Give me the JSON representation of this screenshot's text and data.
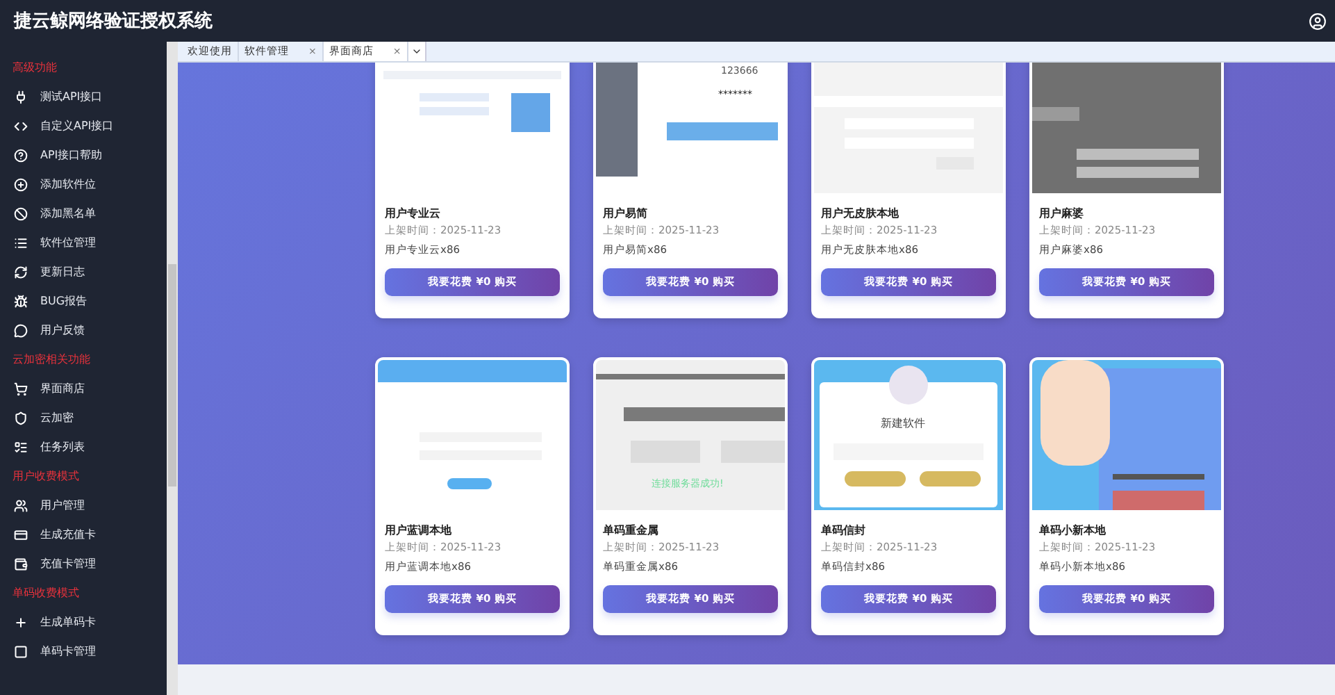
{
  "header": {
    "title": "捷云鲸网络验证授权系统"
  },
  "sidebar": {
    "items": [
      {
        "kind": "section",
        "label": "高级功能"
      },
      {
        "kind": "item",
        "label": "测试API接口"
      },
      {
        "kind": "item",
        "label": "自定义API接口"
      },
      {
        "kind": "item",
        "label": "API接口帮助"
      },
      {
        "kind": "item",
        "label": "添加软件位"
      },
      {
        "kind": "item",
        "label": "添加黑名单"
      },
      {
        "kind": "item",
        "label": "软件位管理"
      },
      {
        "kind": "item",
        "label": "更新日志"
      },
      {
        "kind": "item",
        "label": "BUG报告"
      },
      {
        "kind": "item",
        "label": "用户反馈"
      },
      {
        "kind": "section",
        "label": "云加密相关功能"
      },
      {
        "kind": "item",
        "label": "界面商店"
      },
      {
        "kind": "item",
        "label": "云加密"
      },
      {
        "kind": "item",
        "label": "任务列表"
      },
      {
        "kind": "section",
        "label": "用户收费模式"
      },
      {
        "kind": "item",
        "label": "用户管理"
      },
      {
        "kind": "item",
        "label": "生成充值卡"
      },
      {
        "kind": "item",
        "label": "充值卡管理"
      },
      {
        "kind": "section",
        "label": "单码收费模式"
      },
      {
        "kind": "item",
        "label": "生成单码卡"
      },
      {
        "kind": "item",
        "label": "单码卡管理"
      }
    ]
  },
  "tabs": [
    {
      "label": "欢迎使用",
      "selected": false
    },
    {
      "label": "软件管理",
      "selected": false,
      "close": "×"
    },
    {
      "label": "界面商店",
      "selected": true,
      "close": "×"
    }
  ],
  "cards": [
    {
      "name": "用户专业云",
      "date": "上架时间：2025-11-23",
      "desc": "用户专业云x86",
      "button": "我要花费 ¥0 购买",
      "preview": {
        "kind": "web"
      }
    },
    {
      "name": "用户易简",
      "date": "上架时间：2025-11-23",
      "desc": "用户易简x86",
      "button": "我要花费 ¥0 购买",
      "preview": {
        "kind": "side-login",
        "texts": [
          "123666",
          "*******"
        ]
      }
    },
    {
      "name": "用户无皮肤本地",
      "date": "上架时间：2025-11-23",
      "desc": "用户无皮肤本地x86",
      "button": "我要花费 ¥0 购买",
      "preview": {
        "kind": "plain-login"
      }
    },
    {
      "name": "用户麻婆",
      "date": "上架时间：2025-11-23",
      "desc": "用户麻婆x86",
      "button": "我要花费 ¥0 购买",
      "preview": {
        "kind": "dark-login"
      }
    },
    {
      "name": "用户蓝调本地",
      "date": "上架时间：2025-11-23",
      "desc": "用户蓝调本地x86",
      "button": "我要花费 ¥0 购买",
      "preview": {
        "kind": "blue-login"
      }
    },
    {
      "name": "单码重金属",
      "date": "上架时间：2025-11-23",
      "desc": "单码重金属x86",
      "button": "我要花费 ¥0 购买",
      "preview": {
        "kind": "metal",
        "texts": [
          "连接服务器成功!"
        ]
      }
    },
    {
      "name": "单码信封",
      "date": "上架时间：2025-11-23",
      "desc": "单码信封x86",
      "button": "我要花费 ¥0 购买",
      "preview": {
        "kind": "envelope",
        "texts": [
          "新建软件"
        ]
      }
    },
    {
      "name": "单码小新本地",
      "date": "上架时间：2025-11-23",
      "desc": "单码小新本地x86",
      "button": "我要花费 ¥0 购买",
      "preview": {
        "kind": "cartoon"
      }
    }
  ]
}
